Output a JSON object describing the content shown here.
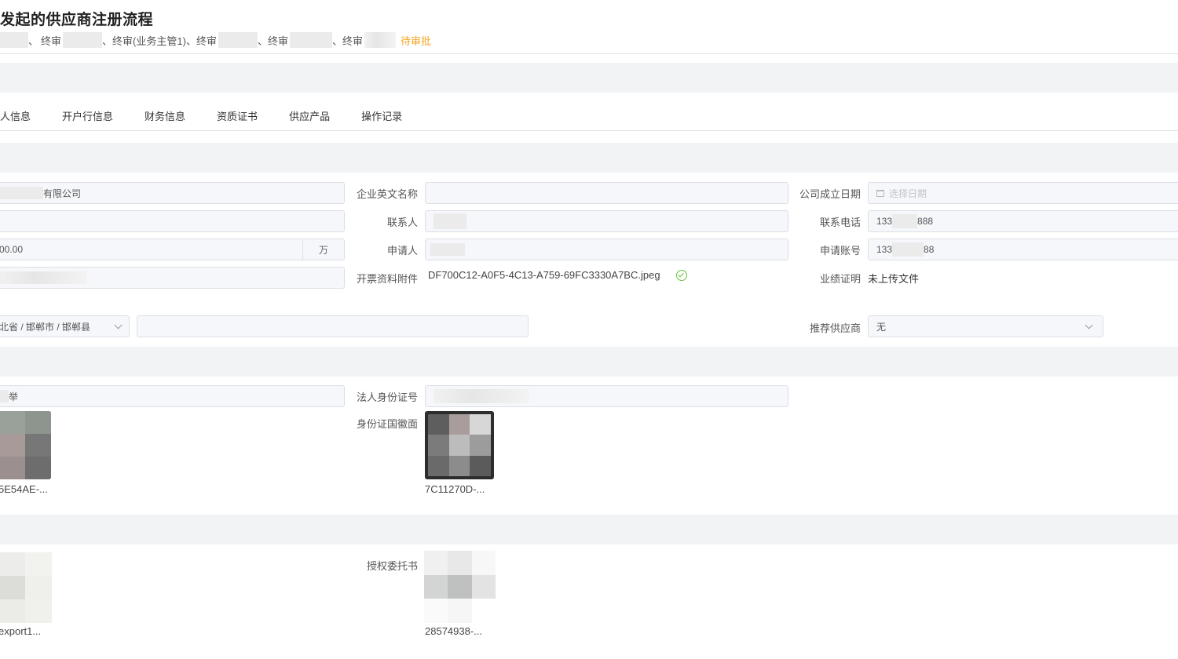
{
  "header": {
    "title": "发起的供应商注册流程",
    "approvers": [
      {
        "sep": "、",
        "label": "终审"
      },
      {
        "sep": "、",
        "label": "终审(业务主管1)"
      },
      {
        "sep": "、",
        "label": "终审"
      },
      {
        "sep": "、",
        "label": "终审"
      },
      {
        "sep": "、",
        "label": "终审"
      }
    ],
    "status": "待审批",
    "status_color": "#f5a623"
  },
  "tabs": [
    "人信息",
    "开户行信息",
    "财务信息",
    "资质证书",
    "供应产品",
    "操作记录"
  ],
  "basic": {
    "company_name_suffix": "有限公司",
    "company_en_label": "企业英文名称",
    "company_en_value": "",
    "founded_label": "公司成立日期",
    "founded_placeholder": "选择日期",
    "contact_label": "联系人",
    "phone_label": "联系电话",
    "phone_prefix": "133",
    "phone_suffix": "888",
    "capital_value": "00.00",
    "capital_unit": "万",
    "applicant_label": "申请人",
    "account_label": "申请账号",
    "account_prefix": "133",
    "account_suffix": "88",
    "invoice_label": "开票资料附件",
    "invoice_file": "DF700C12-A0F5-4C13-A759-69FC3330A7BC.jpeg",
    "performance_label": "业绩证明",
    "performance_value": "未上传文件",
    "region_value": "北省 / 邯郸市 / 邯郸县",
    "recommend_label": "推荐供应商",
    "recommend_value": "无"
  },
  "legal": {
    "name_suffix": "举",
    "id_label": "法人身份证号",
    "emblem_label": "身份证国徽面",
    "front_caption": "5E54AE-...",
    "emblem_caption": "7C11270D-..."
  },
  "auth": {
    "left_caption": "export1...",
    "letter_label": "授权委托书",
    "letter_caption": "28574938-..."
  },
  "colors": {
    "accent_pending": "#f5a623",
    "success": "#67c23a",
    "band": "#f2f3f5"
  }
}
